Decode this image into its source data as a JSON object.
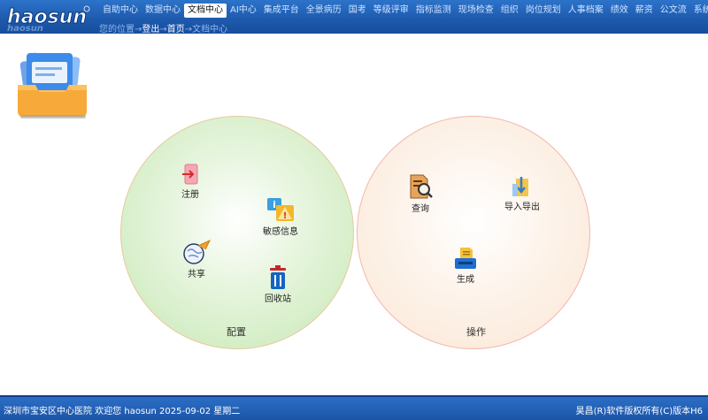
{
  "header": {
    "logo_text": "haosun",
    "nav": [
      {
        "label": "自助中心"
      },
      {
        "label": "数据中心"
      },
      {
        "label": "文档中心",
        "active": true
      },
      {
        "label": "AI中心"
      },
      {
        "label": "集成平台"
      },
      {
        "label": "全景病历"
      },
      {
        "label": "国考"
      },
      {
        "label": "等级评审"
      },
      {
        "label": "指标监测"
      },
      {
        "label": "现场检查"
      },
      {
        "label": "组织"
      },
      {
        "label": "岗位规划"
      },
      {
        "label": "人事档案"
      },
      {
        "label": "绩效"
      },
      {
        "label": "薪资"
      },
      {
        "label": "公文流"
      },
      {
        "label": "系统"
      }
    ],
    "breadcrumb": {
      "prefix": "您的位置→",
      "logout": "登出",
      "sep1": "→",
      "home": "首页",
      "sep2": "→",
      "current": "文档中心"
    }
  },
  "config": {
    "label": "配置",
    "tools": {
      "register": "注册",
      "sensitive": "敏感信息",
      "share": "共享",
      "recycle": "回收站"
    }
  },
  "operations": {
    "label": "操作",
    "tools": {
      "query": "查询",
      "import_export": "导入导出",
      "generate": "生成"
    }
  },
  "footer": {
    "left": "深圳市宝安区中心医院 欢迎您 haosun 2025-09-02 星期二",
    "right": "昊昌(R)软件版权所有(C)版本H6"
  },
  "colors": {
    "header_blue": "#1d59ad",
    "config_green": "#c6e8b3",
    "ops_peach": "#fae6d3"
  }
}
